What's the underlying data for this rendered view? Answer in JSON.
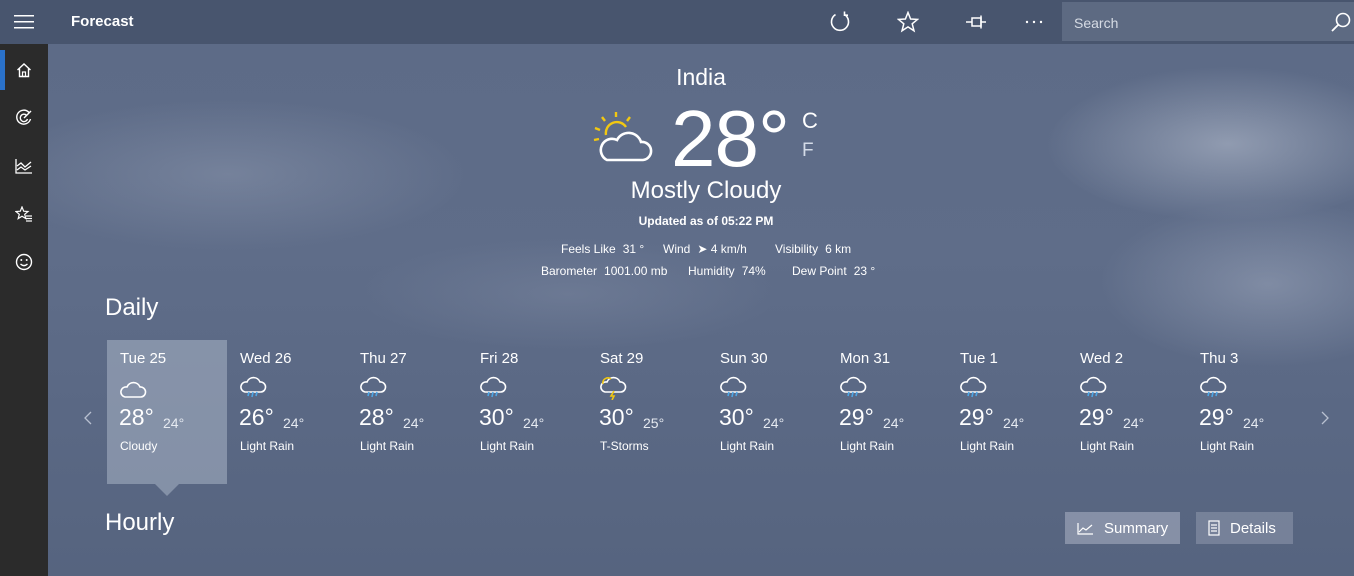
{
  "header": {
    "title": "Forecast",
    "search_placeholder": "Search",
    "icons": [
      "hamburger-menu-icon",
      "refresh-icon",
      "favorite-star-icon",
      "pin-icon",
      "more-options-icon",
      "search-icon"
    ]
  },
  "sidebar": {
    "items": [
      {
        "name": "home",
        "icon": "home-icon",
        "active": true
      },
      {
        "name": "maps",
        "icon": "radar-icon"
      },
      {
        "name": "historical",
        "icon": "chart-icon"
      },
      {
        "name": "places",
        "icon": "favorites-list-icon"
      },
      {
        "name": "feedback",
        "icon": "smiley-icon"
      }
    ]
  },
  "current": {
    "location": "India",
    "temperature": "28°",
    "unit_c": "C",
    "unit_f": "F",
    "condition": "Mostly Cloudy",
    "updated": "Updated as of 05:22 PM",
    "icon": "partly-cloudy-sun-icon",
    "details": {
      "feels_like_label": "Feels Like",
      "feels_like_value": "31 °",
      "wind_label": "Wind",
      "wind_value": "➤ 4 km/h",
      "visibility_label": "Visibility",
      "visibility_value": "6 km",
      "barometer_label": "Barometer",
      "barometer_value": "1001.00 mb",
      "humidity_label": "Humidity",
      "humidity_value": "74%",
      "dew_point_label": "Dew Point",
      "dew_point_value": "23 °"
    }
  },
  "daily": {
    "title": "Daily",
    "days": [
      {
        "name": "Tue 25",
        "hi": "28°",
        "lo": "24°",
        "cond": "Cloudy",
        "icon": "cloud-icon",
        "selected": true
      },
      {
        "name": "Wed 26",
        "hi": "26°",
        "lo": "24°",
        "cond": "Light Rain",
        "icon": "rain-icon"
      },
      {
        "name": "Thu 27",
        "hi": "28°",
        "lo": "24°",
        "cond": "Light Rain",
        "icon": "rain-icon"
      },
      {
        "name": "Fri 28",
        "hi": "30°",
        "lo": "24°",
        "cond": "Light Rain",
        "icon": "rain-icon"
      },
      {
        "name": "Sat 29",
        "hi": "30°",
        "lo": "25°",
        "cond": "T-Storms",
        "icon": "thunderstorm-icon"
      },
      {
        "name": "Sun 30",
        "hi": "30°",
        "lo": "24°",
        "cond": "Light Rain",
        "icon": "rain-icon"
      },
      {
        "name": "Mon 31",
        "hi": "29°",
        "lo": "24°",
        "cond": "Light Rain",
        "icon": "rain-icon"
      },
      {
        "name": "Tue 1",
        "hi": "29°",
        "lo": "24°",
        "cond": "Light Rain",
        "icon": "rain-icon"
      },
      {
        "name": "Wed 2",
        "hi": "29°",
        "lo": "24°",
        "cond": "Light Rain",
        "icon": "rain-icon"
      },
      {
        "name": "Thu 3",
        "hi": "29°",
        "lo": "24°",
        "cond": "Light Rain",
        "icon": "rain-icon"
      }
    ]
  },
  "hourly": {
    "title": "Hourly",
    "summary_label": "Summary",
    "details_label": "Details"
  },
  "colors": {
    "accent": "#2a71c9",
    "sun": "#f2c811",
    "rain": "#4ea6e6"
  }
}
